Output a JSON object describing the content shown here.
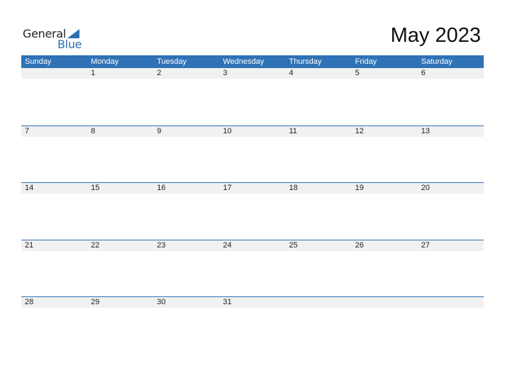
{
  "logo": {
    "line1": "General",
    "line2": "Blue"
  },
  "title": "May 2023",
  "colors": {
    "accent": "#2f72b5",
    "strip": "#f1f1f1"
  },
  "weekdays": [
    "Sunday",
    "Monday",
    "Tuesday",
    "Wednesday",
    "Thursday",
    "Friday",
    "Saturday"
  ],
  "weeks": [
    [
      "",
      "1",
      "2",
      "3",
      "4",
      "5",
      "6"
    ],
    [
      "7",
      "8",
      "9",
      "10",
      "11",
      "12",
      "13"
    ],
    [
      "14",
      "15",
      "16",
      "17",
      "18",
      "19",
      "20"
    ],
    [
      "21",
      "22",
      "23",
      "24",
      "25",
      "26",
      "27"
    ],
    [
      "28",
      "29",
      "30",
      "31",
      "",
      "",
      ""
    ]
  ]
}
